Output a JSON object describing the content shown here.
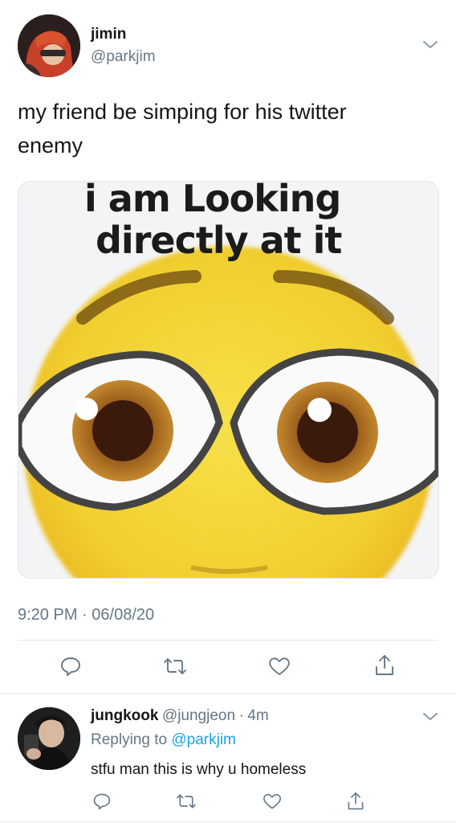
{
  "tweet": {
    "display_name": "jimin",
    "handle": "@parkjim",
    "text_line1": "my friend be simping for his twitter",
    "text_line2": "enemy",
    "meme": {
      "caption_line1": "i am Looking",
      "caption_line2": "directly at it"
    },
    "time": "9:20 PM",
    "separator": "·",
    "date": "06/08/20"
  },
  "reply": {
    "display_name": "jungkook",
    "handle": "@jungjeon",
    "separator": "·",
    "age": "4m",
    "replying_prefix": "Replying to",
    "replying_to": "@parkjim",
    "text": "stfu man this is why u homeless"
  },
  "icons": {
    "reply": "reply-icon",
    "retweet": "retweet-icon",
    "like": "heart-icon",
    "share": "share-icon",
    "menu": "chevron-down-icon"
  },
  "colors": {
    "link": "#1da1f2",
    "secondary_text": "#657786",
    "divider": "#e1e8ed",
    "emoji_yellow": "#f3d43a"
  }
}
